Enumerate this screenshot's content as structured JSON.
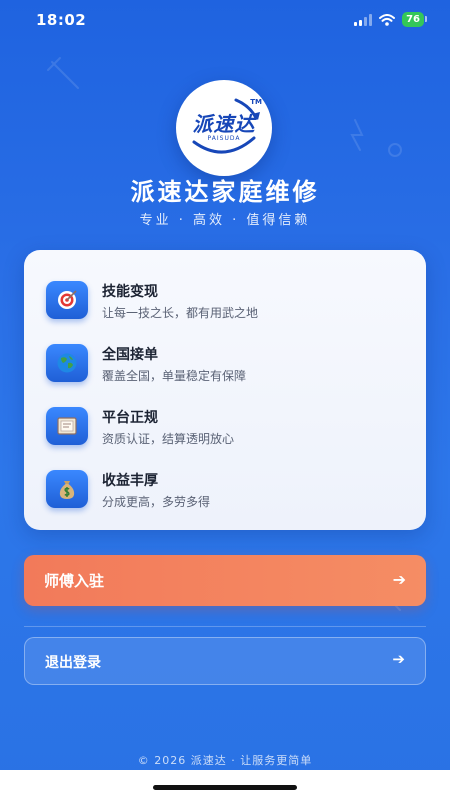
{
  "status_bar": {
    "time": "18:02",
    "battery": "76",
    "icons": [
      "signal-icon",
      "wifi-icon",
      "battery-icon"
    ]
  },
  "logo": {
    "text": "派速达",
    "sub": "PAISUDA",
    "tm": "TM"
  },
  "brand": {
    "title": "派速达家庭维修",
    "subtitle": "专业 · 高效 · 值得信赖"
  },
  "features": [
    {
      "icon": "target-icon",
      "title": "技能变现",
      "desc": "让每一技之长，都有用武之地"
    },
    {
      "icon": "globe-icon",
      "title": "全国接单",
      "desc": "覆盖全国，单量稳定有保障"
    },
    {
      "icon": "certificate-icon",
      "title": "平台正规",
      "desc": "资质认证，结算透明放心"
    },
    {
      "icon": "money-bag-icon",
      "title": "收益丰厚",
      "desc": "分成更高，多劳多得"
    }
  ],
  "actions": {
    "primary_label": "师傅入驻",
    "secondary_label": "退出登录",
    "arrow": "➔"
  },
  "footer": {
    "text": "© 2026 派速达 · 让服务更简单"
  },
  "colors": {
    "background": "#2a6fe6",
    "primary_button": "#f27a5a",
    "brand_blue": "#1747b8",
    "battery": "#34c759"
  }
}
